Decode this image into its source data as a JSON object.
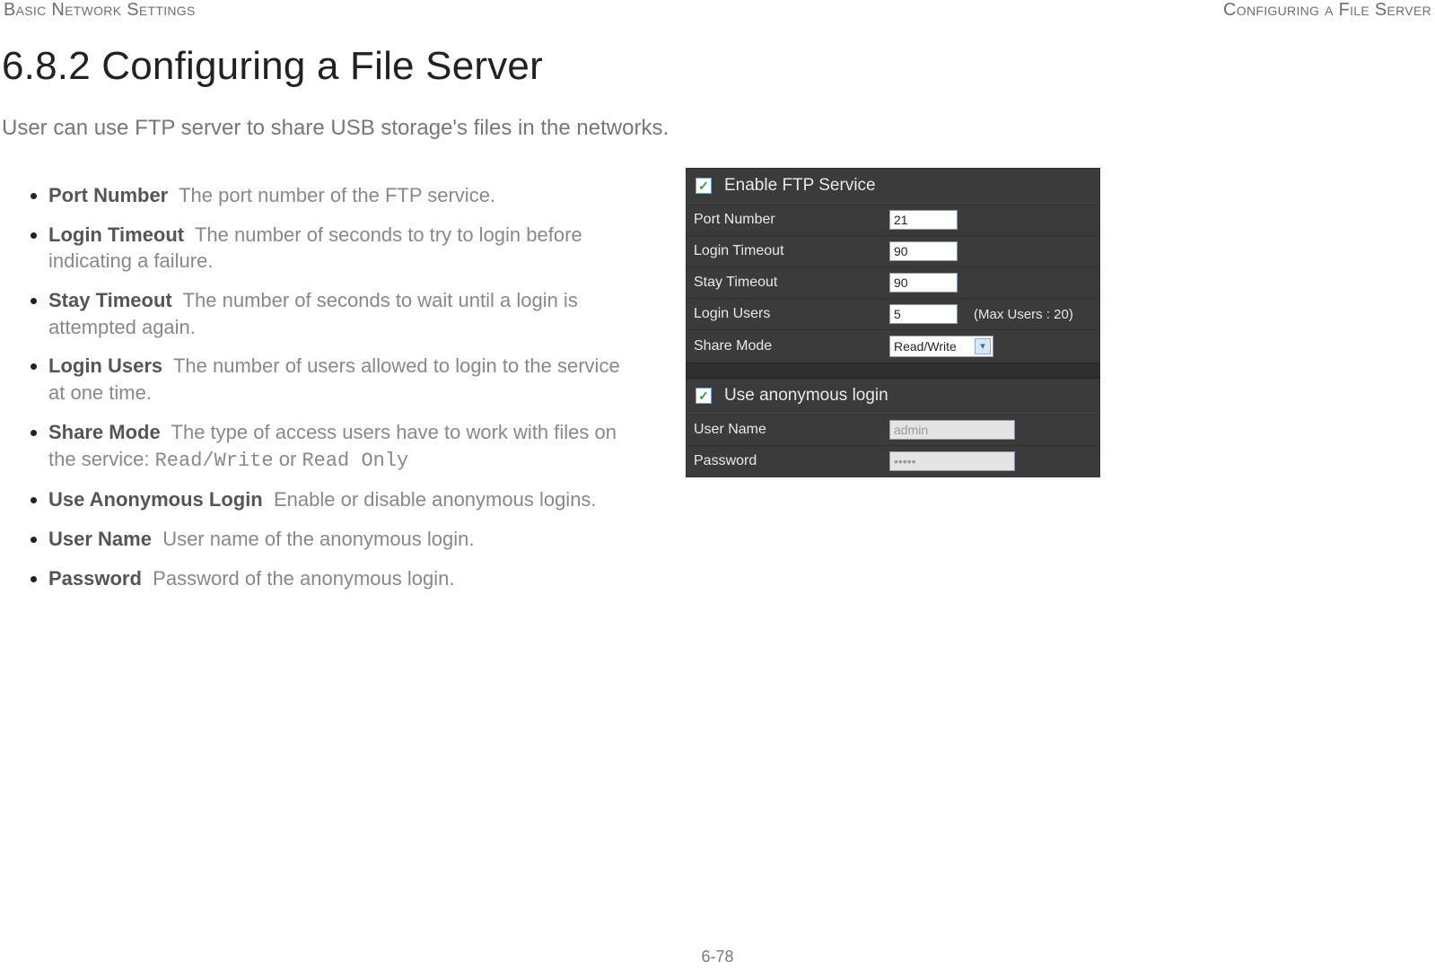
{
  "header": {
    "left": "Basic Network Settings",
    "right": "Configuring a File Server"
  },
  "title": "6.8.2 Configuring a File Server",
  "intro": "User can use FTP server to share USB storage's files in the networks.",
  "defs": [
    {
      "term": "Port Number",
      "desc": "The port number of the FTP service."
    },
    {
      "term": "Login Timeout",
      "desc": "The number of seconds to try to login before indicating a failure."
    },
    {
      "term": "Stay Timeout",
      "desc": "The number of seconds to wait until a login is attempted again."
    },
    {
      "term": "Login Users",
      "desc": "The number of users allowed to login to the service at one time."
    },
    {
      "term": "Share Mode",
      "desc_pre": "The type of access users have to work with files on the service: ",
      "code1": "Read/Write",
      "mid": " or ",
      "code2": "Read Only"
    },
    {
      "term": "Use Anonymous Login",
      "desc": "Enable or disable anonymous logins."
    },
    {
      "term": "User Name",
      "desc": "User name of the anonymous login."
    },
    {
      "term": "Password",
      "desc": "Password of the anonymous login."
    }
  ],
  "panel": {
    "group1_title": "Enable FTP Service",
    "rows1": {
      "port_number": {
        "label": "Port Number",
        "value": "21"
      },
      "login_timeout": {
        "label": "Login Timeout",
        "value": "90"
      },
      "stay_timeout": {
        "label": "Stay Timeout",
        "value": "90"
      },
      "login_users": {
        "label": "Login Users",
        "value": "5",
        "note": "(Max Users : 20)"
      },
      "share_mode": {
        "label": "Share Mode",
        "value": "Read/Write"
      }
    },
    "group2_title": "Use anonymous login",
    "rows2": {
      "user_name": {
        "label": "User Name",
        "value": "admin"
      },
      "password": {
        "label": "Password",
        "value": "•••••"
      }
    }
  },
  "page_number": "6-78"
}
